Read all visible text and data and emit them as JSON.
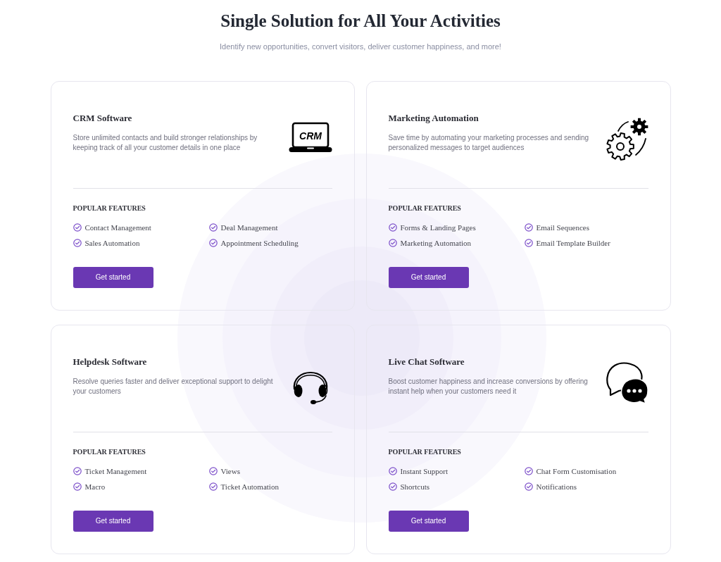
{
  "header": {
    "title": "Single Solution for All Your Activities",
    "subtitle": "Identify new opportunities, convert visitors, deliver customer happiness, and more!"
  },
  "cards": [
    {
      "title": "CRM Software",
      "description": "Store unlimited contacts and build stronger relationships by keeping track of all your customer details in one place",
      "icon": {
        "kind": "laptop",
        "label": "CRM"
      },
      "features_heading": "POPULAR FEATURES",
      "features": [
        "Contact Management",
        "Deal Management",
        "Sales Automation",
        "Appointment Scheduling"
      ],
      "button": "Get started"
    },
    {
      "title": "Marketing Automation",
      "description": "Save time by automating your marketing processes and sending personalized messages to target audiences",
      "icon": {
        "kind": "gears"
      },
      "features_heading": "POPULAR FEATURES",
      "features": [
        "Forms & Landing Pages",
        "Email Sequences",
        "Marketing Automation",
        "Email Template Builder"
      ],
      "button": "Get started"
    },
    {
      "title": "Helpdesk Software",
      "description": "Resolve queries faster and deliver exceptional support to delight your customers",
      "icon": {
        "kind": "headset"
      },
      "features_heading": "POPULAR FEATURES",
      "features": [
        "Ticket Management",
        "Views",
        "Macro",
        "Ticket Automation"
      ],
      "button": "Get started"
    },
    {
      "title": "Live Chat Software",
      "description": "Boost customer happiness and increase conversions by offering instant help when your customers need it",
      "icon": {
        "kind": "chat"
      },
      "features_heading": "POPULAR FEATURES",
      "features": [
        "Instant Support",
        "Chat Form Customisation",
        "Shortcuts",
        "Notifications"
      ],
      "button": "Get started"
    }
  ]
}
